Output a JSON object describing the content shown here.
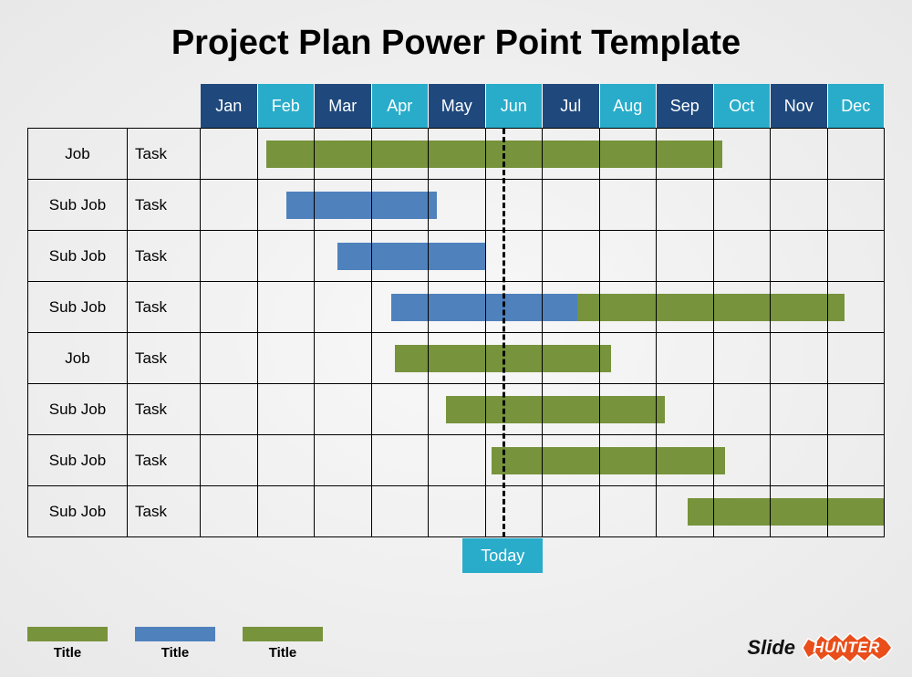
{
  "title": "Project Plan Power Point Template",
  "today_label": "Today",
  "today_month_index": 5.3,
  "months": [
    "Jan",
    "Feb",
    "Mar",
    "Apr",
    "May",
    "Jun",
    "Jul",
    "Aug",
    "Sep",
    "Oct",
    "Nov",
    "Dec"
  ],
  "rows": [
    {
      "job": "Job",
      "task": "Task",
      "bars": [
        {
          "start": 1.15,
          "end": 5.3,
          "color": "green"
        },
        {
          "start": 5.3,
          "end": 9.15,
          "color": "green"
        }
      ]
    },
    {
      "job": "Sub Job",
      "task": "Task",
      "bars": [
        {
          "start": 1.5,
          "end": 4.15,
          "color": "blue"
        }
      ]
    },
    {
      "job": "Sub Job",
      "task": "Task",
      "bars": [
        {
          "start": 2.4,
          "end": 5.0,
          "color": "blue"
        }
      ]
    },
    {
      "job": "Sub Job",
      "task": "Task",
      "bars": [
        {
          "start": 3.35,
          "end": 6.6,
          "color": "blue"
        },
        {
          "start": 6.6,
          "end": 11.3,
          "color": "green"
        }
      ]
    },
    {
      "job": "Job",
      "task": "Task",
      "bars": [
        {
          "start": 3.4,
          "end": 7.2,
          "color": "green"
        }
      ]
    },
    {
      "job": "Sub Job",
      "task": "Task",
      "bars": [
        {
          "start": 4.3,
          "end": 8.15,
          "color": "green"
        }
      ]
    },
    {
      "job": "Sub Job",
      "task": "Task",
      "bars": [
        {
          "start": 5.1,
          "end": 9.2,
          "color": "green"
        }
      ]
    },
    {
      "job": "Sub Job",
      "task": "Task",
      "bars": [
        {
          "start": 8.55,
          "end": 12.0,
          "color": "green"
        }
      ]
    }
  ],
  "legend": [
    {
      "label": "Title",
      "color": "#77933c"
    },
    {
      "label": "Title",
      "color": "#4f81bd"
    },
    {
      "label": "Title",
      "color": "#77933c"
    }
  ],
  "brand": {
    "slide": "Slide",
    "hunter": "HUNTER"
  },
  "chart_data": {
    "type": "bar",
    "orientation": "gantt",
    "title": "Project Plan Power Point Template",
    "x_categories": [
      "Jan",
      "Feb",
      "Mar",
      "Apr",
      "May",
      "Jun",
      "Jul",
      "Aug",
      "Sep",
      "Oct",
      "Nov",
      "Dec"
    ],
    "tasks": [
      {
        "job": "Job",
        "task": "Task",
        "segments": [
          {
            "start_month": "Feb",
            "end_month": "Jun",
            "series": "green"
          },
          {
            "start_month": "Jun",
            "end_month": "Oct",
            "series": "green"
          }
        ]
      },
      {
        "job": "Sub Job",
        "task": "Task",
        "segments": [
          {
            "start_month": "Feb",
            "end_month": "May",
            "series": "blue"
          }
        ]
      },
      {
        "job": "Sub Job",
        "task": "Task",
        "segments": [
          {
            "start_month": "Mar",
            "end_month": "May",
            "series": "blue"
          }
        ]
      },
      {
        "job": "Sub Job",
        "task": "Task",
        "segments": [
          {
            "start_month": "Apr",
            "end_month": "Jul",
            "series": "blue"
          },
          {
            "start_month": "Jul",
            "end_month": "Dec",
            "series": "green"
          }
        ]
      },
      {
        "job": "Job",
        "task": "Task",
        "segments": [
          {
            "start_month": "Apr",
            "end_month": "Aug",
            "series": "green"
          }
        ]
      },
      {
        "job": "Sub Job",
        "task": "Task",
        "segments": [
          {
            "start_month": "May",
            "end_month": "Sep",
            "series": "green"
          }
        ]
      },
      {
        "job": "Sub Job",
        "task": "Task",
        "segments": [
          {
            "start_month": "Jun",
            "end_month": "Oct",
            "series": "green"
          }
        ]
      },
      {
        "job": "Sub Job",
        "task": "Task",
        "segments": [
          {
            "start_month": "Sep",
            "end_month": "Dec",
            "series": "green"
          }
        ]
      }
    ],
    "today_marker": "Jun",
    "legend": [
      {
        "label": "Title",
        "color": "#77933c"
      },
      {
        "label": "Title",
        "color": "#4f81bd"
      },
      {
        "label": "Title",
        "color": "#77933c"
      }
    ]
  }
}
